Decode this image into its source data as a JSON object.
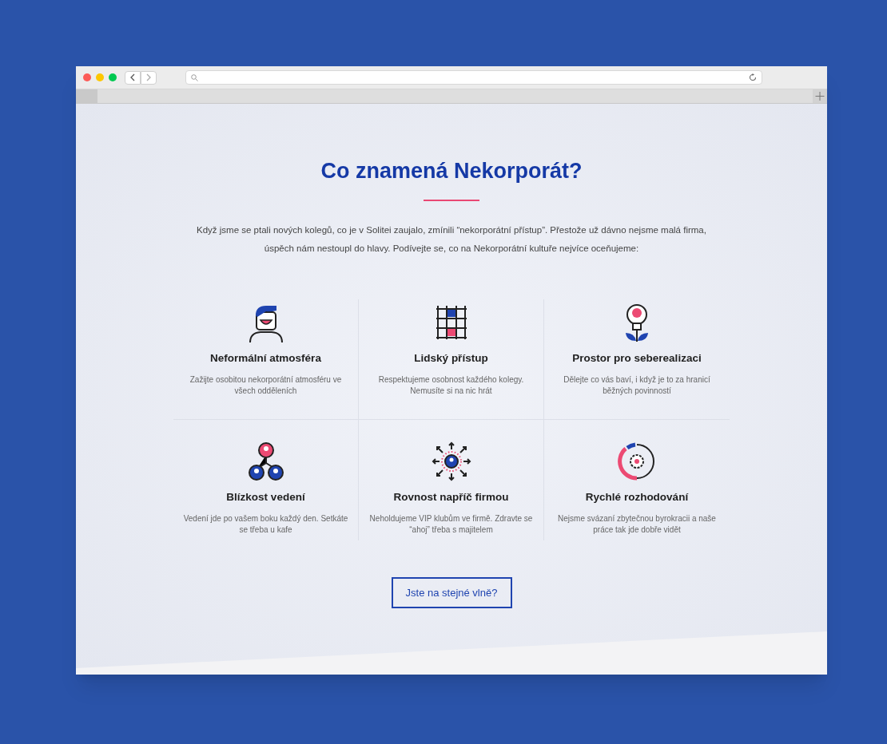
{
  "heading": "Co znamená Nekorporát?",
  "intro": "Když jsme se ptali nových kolegů, co je v Solitei zaujalo, zmínili “nekorporátní přístup”. Přestože už dávno nejsme malá firma, úspěch nám nestoupl do hlavy. Podívejte se, co na Nekorporátní kultuře nejvíce oceňujeme:",
  "features": [
    {
      "kind": "person",
      "title": "Neformální atmosféra",
      "description": "Zažijte osobitou nekorporátní atmosféru ve všech odděleních"
    },
    {
      "kind": "grid",
      "title": "Lidský přístup",
      "description": "Respektujeme osobnost každého kolegy. Nemusíte si na nic hrát"
    },
    {
      "kind": "bulb",
      "title": "Prostor pro seberealizaci",
      "description": "Dělejte co vás baví, i když je to za hranicí běžných povinností"
    },
    {
      "kind": "team",
      "title": "Blízkost vedení",
      "description": "Vedení jde po vašem boku každý den. Setkáte se třeba u kafe"
    },
    {
      "kind": "spread",
      "title": "Rovnost napříč firmou",
      "description": "Neholdujeme VIP klubům ve firmě. Zdravte se “ahoj” třeba s majitelem"
    },
    {
      "kind": "gauge",
      "title": "Rychlé rozhodování",
      "description": "Nejsme svázaní zbytečnou byrokracii a naše práce tak jde dobře vidět"
    }
  ],
  "button": "Jste na stejné vlně?"
}
